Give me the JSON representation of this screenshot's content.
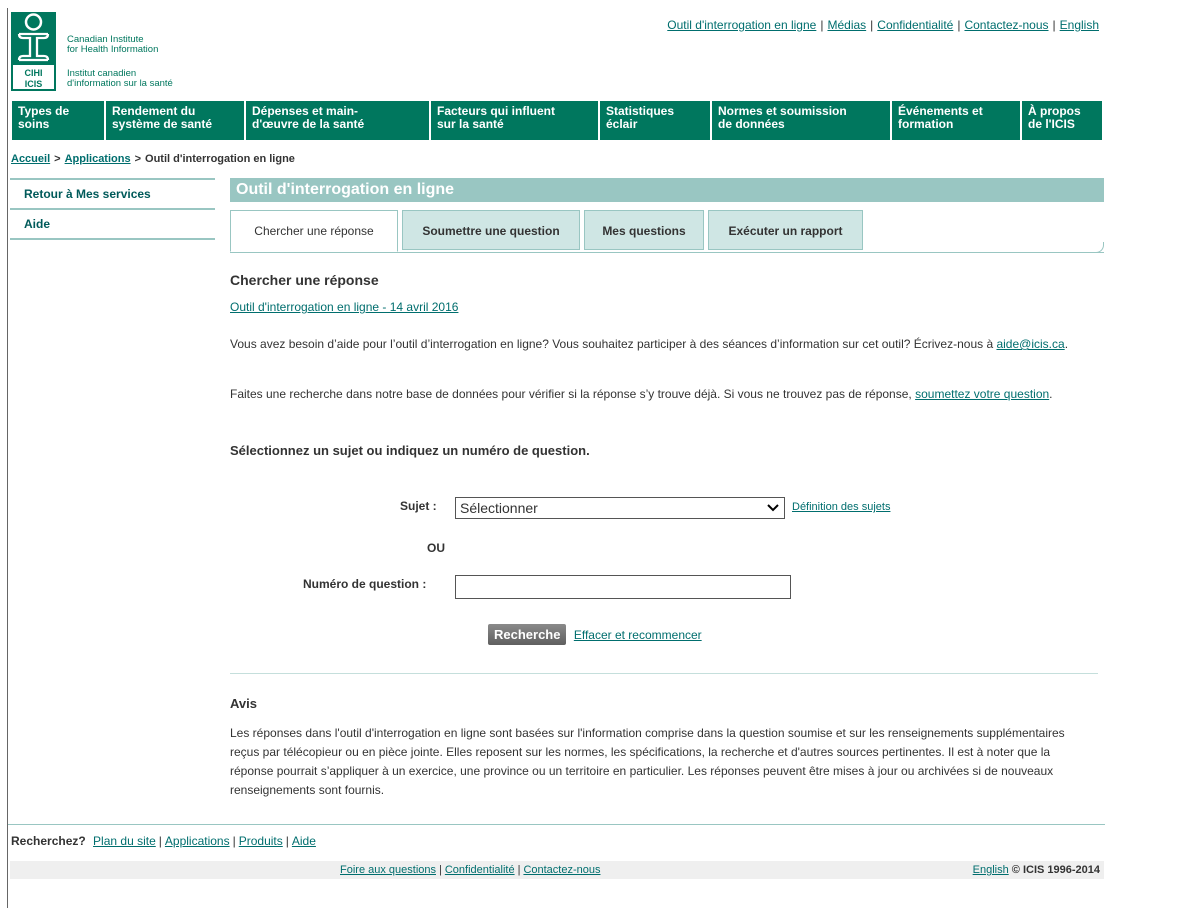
{
  "logo": {
    "en_line1": "Canadian Institute",
    "en_line2": "for Health Information",
    "fr_line1": "Institut canadien",
    "fr_line2": "d'information sur la santé",
    "abbr_en": "CIHI",
    "abbr_fr": "ICIS"
  },
  "utility": [
    "Outil d'interrogation en ligne",
    "Médias",
    "Confidentialité",
    "Contactez-nous",
    "English"
  ],
  "mainnav": [
    {
      "line1": "Types de",
      "line2": "soins"
    },
    {
      "line1": "Rendement du",
      "line2": "système de santé"
    },
    {
      "line1": "Dépenses et main-",
      "line2": "d'œuvre de la santé"
    },
    {
      "line1": "Facteurs qui influent",
      "line2": "sur la santé"
    },
    {
      "line1": "Statistiques",
      "line2": "éclair"
    },
    {
      "line1": "Normes et soumission",
      "line2": "de données"
    },
    {
      "line1": "Événements et",
      "line2": "formation"
    },
    {
      "line1": "À propos",
      "line2": "de l'ICIS"
    }
  ],
  "breadcrumb": {
    "home": "Accueil",
    "apps": "Applications",
    "current": "Outil d'interrogation en ligne",
    "arrow": ">"
  },
  "leftnav": [
    "Retour à Mes services",
    "Aide"
  ],
  "content": {
    "title": "Outil d'interrogation en ligne",
    "tabs": [
      "Chercher une réponse",
      "Soumettre une question",
      "Mes questions",
      "Exécuter un rapport"
    ],
    "heading": "Chercher une réponse",
    "release_link": "Outil d'interrogation en ligne - 14 avril 2016",
    "help_text": "Vous avez besoin d’aide pour l’outil d’interrogation en ligne? Vous souhaitez participer à des séances d’information sur cet outil? Écrivez-nous à",
    "help_email": "aide@icis.ca",
    "help_end": ".",
    "search_text": "Faites une recherche dans notre base de données pour vérifier si la réponse s’y trouve déjà. Si vous ne trouvez pas de réponse,",
    "search_link": "soumettez votre question",
    "search_end": ".",
    "instruction": "Sélectionnez un sujet ou indiquez un numéro de question.",
    "subject_label": "Sujet :",
    "subject_value": "Sélectionner",
    "subject_def_link": "Définition des sujets",
    "or_text": "OU",
    "question_label": "Numéro de question :",
    "question_value": "",
    "search_button": "Recherche",
    "reset_link": "Effacer et recommencer",
    "notice_heading": "Avis",
    "notice_text": "Les réponses dans l'outil d'interrogation en ligne sont basées sur l'information comprise dans la question soumise et sur les renseignements supplémentaires reçus par télécopieur ou en pièce jointe. Elles reposent sur les normes, les spécifications, la recherche et d'autres sources pertinentes. Il est à noter que la réponse pourrait s’appliquer à un exercice, une province ou un territoire en particulier. Les réponses peuvent être mises à jour ou archivées si de nouveaux renseignements sont fournis."
  },
  "footer": {
    "search_label": "Recherchez?",
    "links": [
      "Plan du site",
      "Applications",
      "Produits",
      "Aide"
    ],
    "bottom_links": [
      "Foire aux questions",
      "Confidentialité",
      "Contactez-nous"
    ],
    "english": "English",
    "copyright": "© ICIS 1996-2014"
  }
}
